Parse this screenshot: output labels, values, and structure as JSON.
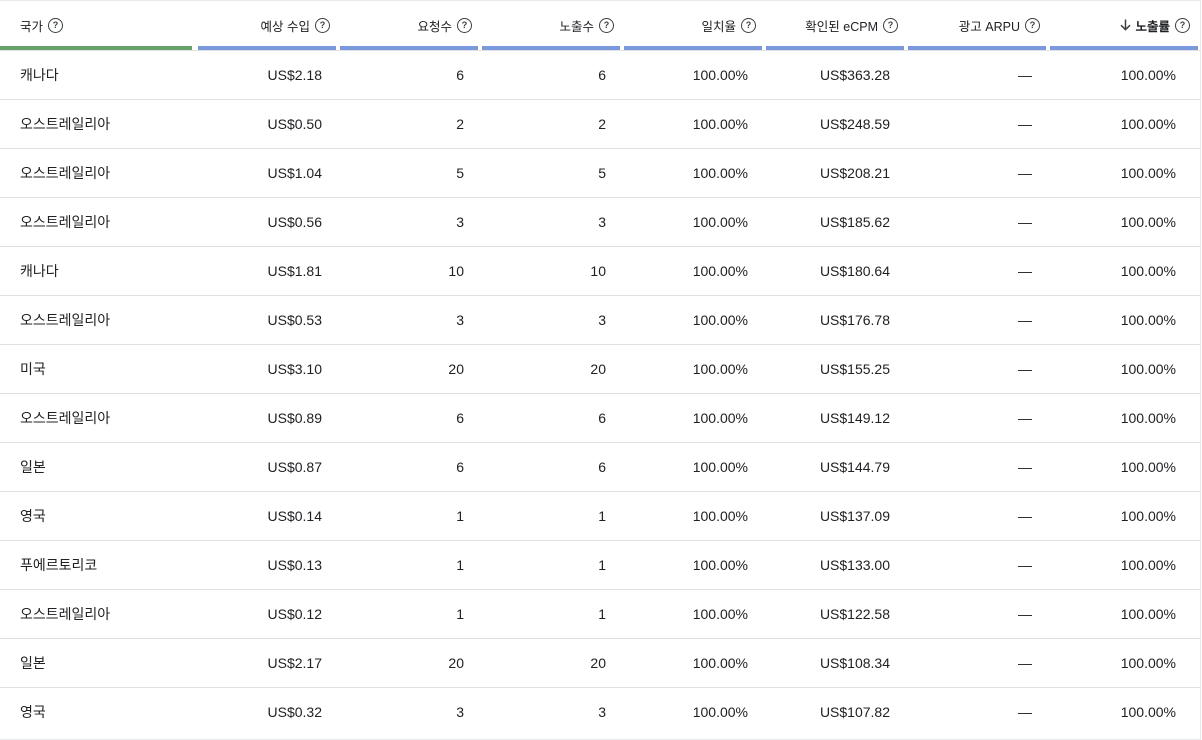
{
  "table": {
    "columns": [
      {
        "label": "국가",
        "align": "left",
        "bar_color": "#66a36c"
      },
      {
        "label": "예상 수입",
        "align": "right"
      },
      {
        "label": "요청수",
        "align": "right"
      },
      {
        "label": "노출수",
        "align": "right"
      },
      {
        "label": "일치율",
        "align": "right"
      },
      {
        "label": "확인된 eCPM",
        "align": "right"
      },
      {
        "label": "광고 ARPU",
        "align": "right"
      },
      {
        "label": "노출률",
        "align": "right",
        "sorted": "descending"
      }
    ],
    "help_icon_glyph": "?",
    "accent_bar_color": "#7a99dc",
    "rows": [
      [
        "캐나다",
        "US$2.18",
        "6",
        "6",
        "100.00%",
        "US$363.28",
        "—",
        "100.00%"
      ],
      [
        "오스트레일리아",
        "US$0.50",
        "2",
        "2",
        "100.00%",
        "US$248.59",
        "—",
        "100.00%"
      ],
      [
        "오스트레일리아",
        "US$1.04",
        "5",
        "5",
        "100.00%",
        "US$208.21",
        "—",
        "100.00%"
      ],
      [
        "오스트레일리아",
        "US$0.56",
        "3",
        "3",
        "100.00%",
        "US$185.62",
        "—",
        "100.00%"
      ],
      [
        "캐나다",
        "US$1.81",
        "10",
        "10",
        "100.00%",
        "US$180.64",
        "—",
        "100.00%"
      ],
      [
        "오스트레일리아",
        "US$0.53",
        "3",
        "3",
        "100.00%",
        "US$176.78",
        "—",
        "100.00%"
      ],
      [
        "미국",
        "US$3.10",
        "20",
        "20",
        "100.00%",
        "US$155.25",
        "—",
        "100.00%"
      ],
      [
        "오스트레일리아",
        "US$0.89",
        "6",
        "6",
        "100.00%",
        "US$149.12",
        "—",
        "100.00%"
      ],
      [
        "일본",
        "US$0.87",
        "6",
        "6",
        "100.00%",
        "US$144.79",
        "—",
        "100.00%"
      ],
      [
        "영국",
        "US$0.14",
        "1",
        "1",
        "100.00%",
        "US$137.09",
        "—",
        "100.00%"
      ],
      [
        "푸에르토리코",
        "US$0.13",
        "1",
        "1",
        "100.00%",
        "US$133.00",
        "—",
        "100.00%"
      ],
      [
        "오스트레일리아",
        "US$0.12",
        "1",
        "1",
        "100.00%",
        "US$122.58",
        "—",
        "100.00%"
      ],
      [
        "일본",
        "US$2.17",
        "20",
        "20",
        "100.00%",
        "US$108.34",
        "—",
        "100.00%"
      ],
      [
        "영국",
        "US$0.32",
        "3",
        "3",
        "100.00%",
        "US$107.82",
        "—",
        "100.00%"
      ]
    ]
  }
}
